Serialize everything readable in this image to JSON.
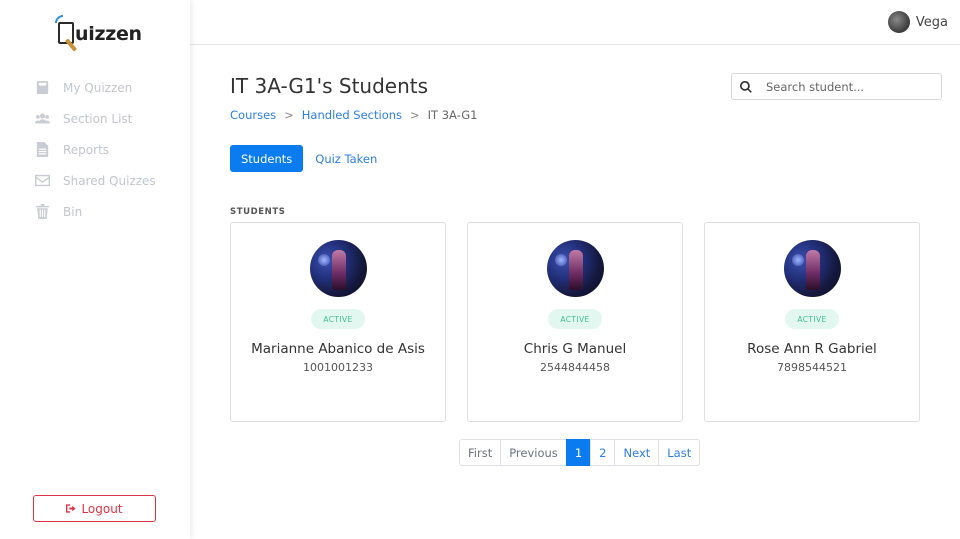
{
  "app": {
    "logo_text": "uizzen"
  },
  "sidebar": {
    "items": [
      {
        "label": "My Quizzen",
        "icon": "book-icon"
      },
      {
        "label": "Section List",
        "icon": "users-icon"
      },
      {
        "label": "Reports",
        "icon": "file-report-icon"
      },
      {
        "label": "Shared Quizzes",
        "icon": "envelope-icon"
      },
      {
        "label": "Bin",
        "icon": "trash-icon"
      }
    ],
    "logout_label": "Logout"
  },
  "topbar": {
    "user_name": "Vega"
  },
  "page": {
    "title": "IT 3A-G1's Students",
    "search_placeholder": "Search student..."
  },
  "breadcrumb": {
    "items": [
      "Courses",
      "Handled Sections"
    ],
    "current": "IT 3A-G1"
  },
  "tabs": {
    "active": "Students",
    "other": "Quiz Taken"
  },
  "section_label": "STUDENTS",
  "students": [
    {
      "name": "Marianne Abanico de Asis",
      "id": "1001001233",
      "status": "ACTIVE"
    },
    {
      "name": "Chris G Manuel",
      "id": "2544844458",
      "status": "ACTIVE"
    },
    {
      "name": "Rose Ann R Gabriel",
      "id": "7898544521",
      "status": "ACTIVE"
    }
  ],
  "pagination": {
    "first": "First",
    "previous": "Previous",
    "pages": [
      "1",
      "2"
    ],
    "current": "1",
    "next": "Next",
    "last": "Last"
  },
  "colors": {
    "primary": "#0a7cf0",
    "danger": "#dc3545",
    "badge_text": "#3cbf94",
    "badge_bg": "#e3f7f1"
  }
}
